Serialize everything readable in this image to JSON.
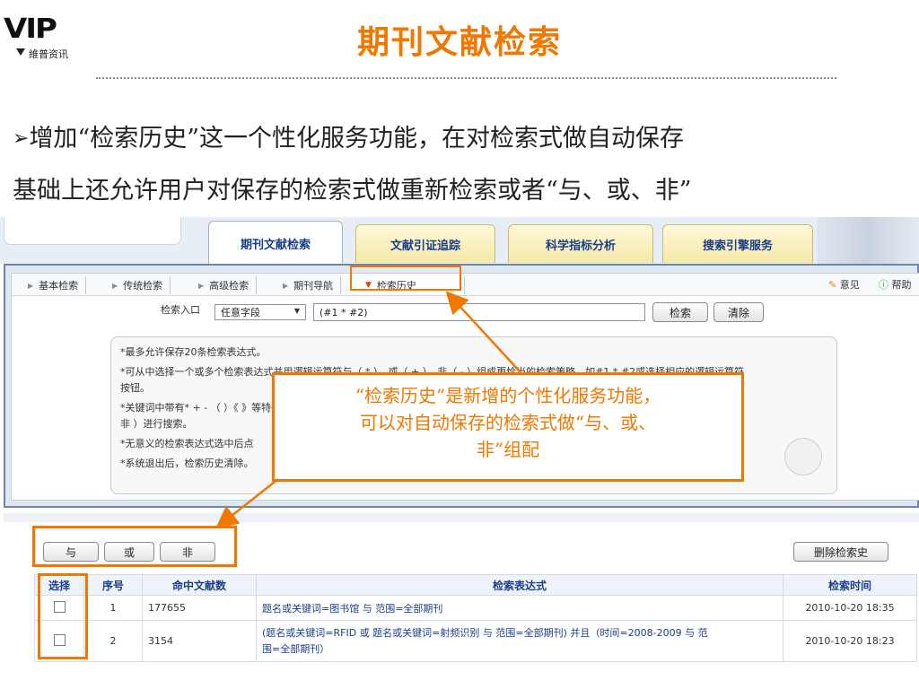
{
  "slide": {
    "logo_text": "VIP",
    "logo_subtitle": "維普资讯",
    "title": "期刊文献检索",
    "bullet_arrow": "➢",
    "paragraph_line1": "增加“检索历史”这一个性化服务功能，在对检索式做自动保存",
    "paragraph_line2": "基础上还允许用户对保存的检索式做重新检索或者“与、或、非”"
  },
  "main_tabs": [
    {
      "label": "期刊文献检索",
      "active": true
    },
    {
      "label": "文献引证追踪",
      "active": false
    },
    {
      "label": "科学指标分析",
      "active": false
    },
    {
      "label": "搜索引擎服务",
      "active": false
    }
  ],
  "sub_tabs": [
    {
      "label": "基本检索"
    },
    {
      "label": "传统检索"
    },
    {
      "label": "高级检索"
    },
    {
      "label": "期刊导航"
    },
    {
      "label": "检索历史",
      "selected": true
    }
  ],
  "feedback_label": "意见",
  "help_label": "帮助",
  "search": {
    "entry_label": "检索入口",
    "field_selected": "任意字段",
    "query_value": "(#1 * #2)",
    "search_button": "检索",
    "clear_button": "清除"
  },
  "tips": [
    "*最多允许保存20条检索表达式。",
    "*可从中选择一个或多个检索表达式并用逻辑运算符与（ * ）、或（ + ）、非（ - ）组成更恰当的检索策略，如#1 * #2或选择相应的逻辑运算符",
    "按钮。",
    "*关键词中带有* + - （ ）《 》等特殊字符的检索表达式在进行组配时请使用括号并使用逻辑运算符（ 与 或",
    "非 ）进行搜索。",
    "*无意义的检索表达式选中后点",
    "*系统退出后，检索历史清除。"
  ],
  "callout": {
    "line1": "“检索历史”是新增的个性化服务功能，",
    "line2": "可以对自动保存的检索式做“与、或、",
    "line3": "非”组配"
  },
  "logic_buttons": {
    "and": "与",
    "or": "或",
    "not": "非"
  },
  "delete_history_button": "删除检索史",
  "table": {
    "headers": [
      "选择",
      "序号",
      "命中文献数",
      "检索表达式",
      "检索时间"
    ],
    "rows": [
      {
        "seq": "1",
        "hits": "177655",
        "expr": "题名或关键词=图书馆 与 范围=全部期刊",
        "expr2": "",
        "time": "2010-10-20 18:35"
      },
      {
        "seq": "2",
        "hits": "3154",
        "expr": "(题名或关键词=RFID 或 题名或关键词=射频识别 与 范围=全部期刊) 并且（时间=2008-2009 与 范",
        "expr2": "围=全部期刊）",
        "time": "2010-10-20 18:23"
      }
    ]
  },
  "colors": {
    "accent_orange": "#f07800",
    "link_blue": "#1a3e8a",
    "frame_blue": "#6c86ad"
  }
}
